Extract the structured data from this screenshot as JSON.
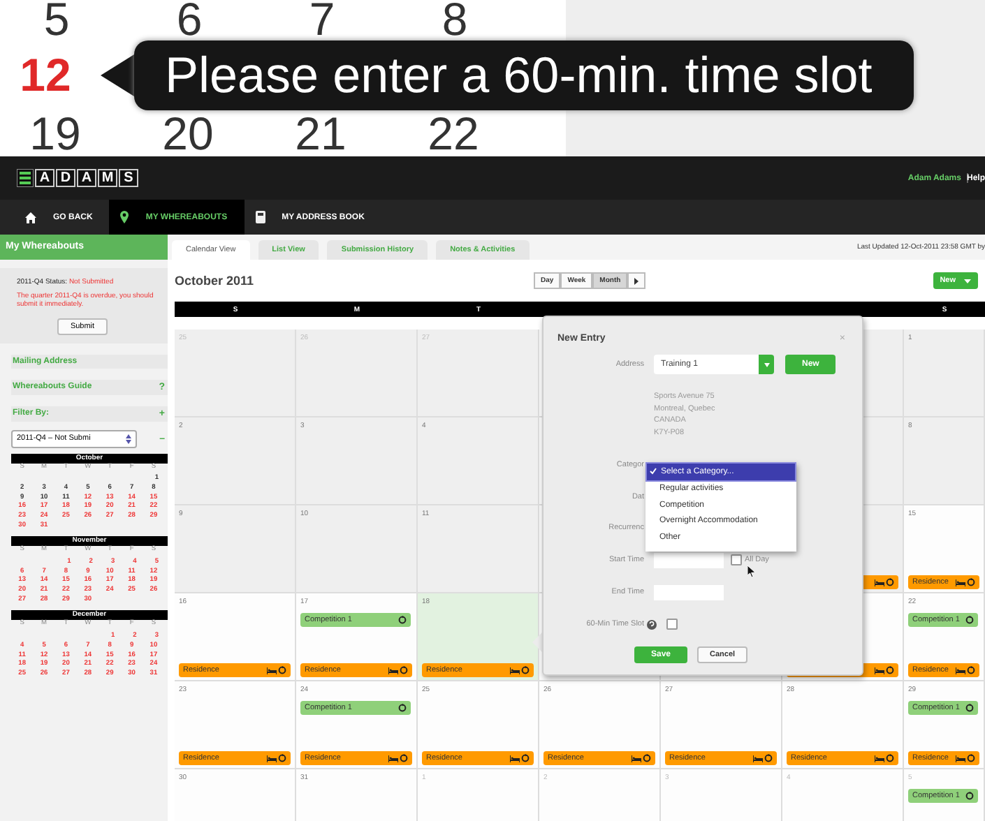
{
  "callout": {
    "dates_above": [
      "5",
      "6",
      "7",
      "8"
    ],
    "today": "12",
    "tooltip": "Please enter a 60-min. time slot",
    "dates_below": [
      "19",
      "20",
      "21",
      "22"
    ]
  },
  "header": {
    "logo_letters": [
      "A",
      "D",
      "A",
      "M",
      "S"
    ],
    "user": "Adam Adams",
    "help": "Help"
  },
  "nav": [
    {
      "label": "GO BACK",
      "kind": "home",
      "selected": false
    },
    {
      "label": "MY WHEREABOUTS",
      "kind": "pin",
      "selected": true
    },
    {
      "label": "MY ADDRESS BOOK",
      "kind": "book",
      "selected": false
    }
  ],
  "sidebar": {
    "title": "My Whereabouts",
    "status_label": "2011-Q4 Status:",
    "status_value": "Not Submitted",
    "warning": "The quarter 2011-Q4 is overdue, you should submit it immediately.",
    "submit": "Submit",
    "links": [
      {
        "label": "Mailing Address"
      },
      {
        "label": "Whereabouts Guide",
        "action": "?"
      },
      {
        "label": "Filter By:",
        "action": "+"
      }
    ],
    "filter": {
      "value": "2011-Q4 – Not Submi",
      "action": "–"
    },
    "months": [
      {
        "name": "October",
        "weekdays": [
          "S",
          "M",
          "T",
          "W",
          "T",
          "F",
          "S"
        ],
        "weeks": [
          [
            {
              "day": "1",
              "upcoming": false
            }
          ],
          [
            {
              "day": "2",
              "upcoming": false
            },
            {
              "day": "3",
              "upcoming": false
            },
            {
              "day": "4",
              "upcoming": false
            },
            {
              "day": "5",
              "upcoming": false
            },
            {
              "day": "6",
              "upcoming": false
            },
            {
              "day": "7",
              "upcoming": false
            },
            {
              "day": "8",
              "upcoming": false
            }
          ],
          [
            {
              "day": "9",
              "upcoming": false
            },
            {
              "day": "10",
              "upcoming": false
            },
            {
              "day": "11",
              "upcoming": false
            },
            {
              "day": "12",
              "upcoming": true
            },
            {
              "day": "13",
              "upcoming": true
            },
            {
              "day": "14",
              "upcoming": true
            },
            {
              "day": "15",
              "upcoming": true
            }
          ],
          [
            {
              "day": "16",
              "upcoming": true
            },
            {
              "day": "17",
              "upcoming": true
            },
            {
              "day": "18",
              "upcoming": true
            },
            {
              "day": "19",
              "upcoming": true
            },
            {
              "day": "20",
              "upcoming": true
            },
            {
              "day": "21",
              "upcoming": true
            },
            {
              "day": "22",
              "upcoming": true
            }
          ],
          [
            {
              "day": "23",
              "upcoming": true
            },
            {
              "day": "24",
              "upcoming": true
            },
            {
              "day": "25",
              "upcoming": true
            },
            {
              "day": "26",
              "upcoming": true
            },
            {
              "day": "27",
              "upcoming": true
            },
            {
              "day": "28",
              "upcoming": true
            },
            {
              "day": "29",
              "upcoming": true
            }
          ],
          [
            {
              "day": "30",
              "upcoming": true
            },
            {
              "day": "31",
              "upcoming": true
            }
          ]
        ]
      },
      {
        "name": "November",
        "weekdays": [
          "S",
          "M",
          "T",
          "W",
          "T",
          "F",
          "S"
        ],
        "weeks": [
          [
            {
              "day": "1",
              "upcoming": true
            },
            {
              "day": "2",
              "upcoming": true
            },
            {
              "day": "3",
              "upcoming": true
            },
            {
              "day": "4",
              "upcoming": true
            },
            {
              "day": "5",
              "upcoming": true
            }
          ],
          [
            {
              "day": "6",
              "upcoming": true
            },
            {
              "day": "7",
              "upcoming": true
            },
            {
              "day": "8",
              "upcoming": true
            },
            {
              "day": "9",
              "upcoming": true
            },
            {
              "day": "10",
              "upcoming": true
            },
            {
              "day": "11",
              "upcoming": true
            },
            {
              "day": "12",
              "upcoming": true
            }
          ],
          [
            {
              "day": "13",
              "upcoming": true
            },
            {
              "day": "14",
              "upcoming": true
            },
            {
              "day": "15",
              "upcoming": true
            },
            {
              "day": "16",
              "upcoming": true
            },
            {
              "day": "17",
              "upcoming": true
            },
            {
              "day": "18",
              "upcoming": true
            },
            {
              "day": "19",
              "upcoming": true
            }
          ],
          [
            {
              "day": "20",
              "upcoming": true
            },
            {
              "day": "21",
              "upcoming": true
            },
            {
              "day": "22",
              "upcoming": true
            },
            {
              "day": "23",
              "upcoming": true
            },
            {
              "day": "24",
              "upcoming": true
            },
            {
              "day": "25",
              "upcoming": true
            },
            {
              "day": "26",
              "upcoming": true
            }
          ],
          [
            {
              "day": "27",
              "upcoming": true
            },
            {
              "day": "28",
              "upcoming": true
            },
            {
              "day": "29",
              "upcoming": true
            },
            {
              "day": "30",
              "upcoming": true
            }
          ]
        ]
      },
      {
        "name": "December",
        "weekdays": [
          "S",
          "M",
          "T",
          "W",
          "T",
          "F",
          "S"
        ],
        "weeks": [
          [
            {
              "day": "1",
              "upcoming": true
            },
            {
              "day": "2",
              "upcoming": true
            },
            {
              "day": "3",
              "upcoming": true
            }
          ],
          [
            {
              "day": "4",
              "upcoming": true
            },
            {
              "day": "5",
              "upcoming": true
            },
            {
              "day": "6",
              "upcoming": true
            },
            {
              "day": "7",
              "upcoming": true
            },
            {
              "day": "8",
              "upcoming": true
            },
            {
              "day": "9",
              "upcoming": true
            },
            {
              "day": "10",
              "upcoming": true
            }
          ],
          [
            {
              "day": "11",
              "upcoming": true
            },
            {
              "day": "12",
              "upcoming": true
            },
            {
              "day": "13",
              "upcoming": true
            },
            {
              "day": "14",
              "upcoming": true
            },
            {
              "day": "15",
              "upcoming": true
            },
            {
              "day": "16",
              "upcoming": true
            },
            {
              "day": "17",
              "upcoming": true
            }
          ],
          [
            {
              "day": "18",
              "upcoming": true
            },
            {
              "day": "19",
              "upcoming": true
            },
            {
              "day": "20",
              "upcoming": true
            },
            {
              "day": "21",
              "upcoming": true
            },
            {
              "day": "22",
              "upcoming": true
            },
            {
              "day": "23",
              "upcoming": true
            },
            {
              "day": "24",
              "upcoming": true
            }
          ],
          [
            {
              "day": "25",
              "upcoming": true
            },
            {
              "day": "26",
              "upcoming": true
            },
            {
              "day": "27",
              "upcoming": true
            },
            {
              "day": "28",
              "upcoming": true
            },
            {
              "day": "29",
              "upcoming": true
            },
            {
              "day": "30",
              "upcoming": true
            },
            {
              "day": "31",
              "upcoming": true
            }
          ]
        ]
      }
    ]
  },
  "tabs": [
    {
      "label": "Calendar View",
      "selected": true
    },
    {
      "label": "List View",
      "selected": false
    },
    {
      "label": "Submission History",
      "selected": false
    },
    {
      "label": "Notes & Activities",
      "selected": false
    }
  ],
  "last_updated": "Last Updated 12-Oct-2011 23:58 GMT by",
  "calendar": {
    "title": "October 2011",
    "views": [
      {
        "label": "Day",
        "selected": false
      },
      {
        "label": "Week",
        "selected": false
      },
      {
        "label": "Month",
        "selected": true
      }
    ],
    "new_button": "New",
    "weekdays": [
      "S",
      "M",
      "T",
      "S"
    ],
    "weeks": [
      [
        {
          "date": "25",
          "other_month": true,
          "past": true,
          "selected": false
        },
        {
          "date": "26",
          "other_month": true,
          "past": true,
          "selected": false
        },
        {
          "date": "27",
          "other_month": true,
          "past": true,
          "selected": false
        },
        {
          "past": true,
          "selected": false
        },
        {
          "date": "1",
          "other_month": false,
          "past": true,
          "selected": false
        }
      ],
      [
        {
          "date": "2",
          "other_month": false,
          "past": true,
          "selected": false
        },
        {
          "date": "3",
          "other_month": false,
          "past": true,
          "selected": false
        },
        {
          "date": "4",
          "other_month": false,
          "past": true,
          "selected": false
        },
        {
          "past": true,
          "selected": false
        },
        {
          "date": "8",
          "other_month": false,
          "past": true,
          "selected": false
        }
      ],
      [
        {
          "date": "9",
          "other_month": false,
          "past": true,
          "selected": false
        },
        {
          "date": "10",
          "other_month": false,
          "past": true,
          "selected": false
        },
        {
          "date": "11",
          "other_month": false,
          "past": true,
          "selected": false
        },
        {
          "past": true,
          "selected": false,
          "events": [
            {
              "kind": "residence"
            }
          ]
        },
        {
          "date": "15",
          "other_month": false,
          "past": false,
          "selected": false,
          "events": [
            {
              "kind": "residence",
              "label": "Residence"
            }
          ]
        }
      ],
      [
        {
          "date": "16",
          "other_month": false,
          "past": false,
          "selected": false,
          "events": [
            {
              "kind": "residence",
              "label": "Residence"
            }
          ]
        },
        {
          "date": "17",
          "other_month": false,
          "past": false,
          "selected": false,
          "events": [
            {
              "kind": "competition",
              "label": "Competition 1"
            },
            {
              "kind": "residence",
              "label": "Residence"
            }
          ]
        },
        {
          "date": "18",
          "other_month": false,
          "past": false,
          "selected": true,
          "events": [
            {
              "kind": "residence",
              "label": "Residence"
            }
          ]
        },
        {
          "past": false,
          "selected": false,
          "events": [
            {
              "kind": "residence"
            }
          ]
        },
        {
          "date": "22",
          "other_month": false,
          "past": false,
          "selected": false,
          "events": [
            {
              "kind": "competition",
              "label": "Competition 1"
            },
            {
              "kind": "residence",
              "label": "Residence"
            }
          ]
        }
      ],
      [
        {
          "date": "23",
          "other_month": false,
          "past": false,
          "selected": false,
          "events": [
            {
              "kind": "residence",
              "label": "Residence"
            }
          ]
        },
        {
          "date": "24",
          "other_month": false,
          "past": false,
          "selected": false,
          "events": [
            {
              "kind": "competition",
              "label": "Competition 1"
            },
            {
              "kind": "residence",
              "label": "Residence"
            }
          ]
        },
        {
          "date": "25",
          "other_month": false,
          "past": false,
          "selected": false,
          "events": [
            {
              "kind": "residence",
              "label": "Residence"
            }
          ]
        },
        {
          "date": "26",
          "other_month": false,
          "past": false,
          "selected": false,
          "events": [
            {
              "kind": "residence",
              "label": "Residence"
            }
          ]
        },
        {
          "date": "27",
          "other_month": false,
          "past": false,
          "selected": false,
          "events": [
            {
              "kind": "residence",
              "label": "Residence"
            }
          ]
        },
        {
          "date": "28",
          "other_month": false,
          "past": false,
          "selected": false,
          "events": [
            {
              "kind": "residence",
              "label": "Residence"
            }
          ]
        },
        {
          "date": "29",
          "other_month": false,
          "past": false,
          "selected": false,
          "events": [
            {
              "kind": "competition",
              "label": "Competition 1"
            },
            {
              "kind": "residence",
              "label": "Residence"
            }
          ]
        }
      ],
      [
        {
          "date": "30",
          "other_month": false,
          "past": false,
          "selected": false
        },
        {
          "date": "31",
          "other_month": false,
          "past": false,
          "selected": false
        },
        {
          "date": "1",
          "other_month": true,
          "past": false,
          "selected": false
        },
        {
          "date": "2",
          "other_month": true,
          "past": false,
          "selected": false
        },
        {
          "date": "3",
          "other_month": true,
          "past": false,
          "selected": false
        },
        {
          "date": "4",
          "other_month": true,
          "past": false,
          "selected": false
        },
        {
          "date": "5",
          "other_month": true,
          "past": false,
          "selected": false,
          "events": [
            {
              "kind": "competition",
              "label": "Competition 1"
            }
          ]
        }
      ]
    ]
  },
  "dialog": {
    "title": "New Entry",
    "close": "×",
    "address_label": "Address",
    "address_value": "Training 1",
    "new_button": "New",
    "address_lines": [
      "Sports Avenue 75",
      "Montreal, Quebec",
      "CANADA",
      "K7Y-P08"
    ],
    "rows": [
      {
        "kind": "label",
        "label": "Categor"
      },
      {
        "kind": "label",
        "label": "Dat"
      },
      {
        "kind": "label",
        "label": "Recurrenc"
      },
      {
        "kind": "time",
        "label": "Start Time",
        "all_day": {
          "label": "All Day",
          "checked": false
        }
      },
      {
        "kind": "time",
        "label": "End Time"
      },
      {
        "kind": "checkbox",
        "label": "60-Min Time Slot",
        "help": true,
        "checked": false
      }
    ],
    "category_menu": [
      {
        "label": "Select a Category...",
        "selected": true
      },
      {
        "label": "Regular activities",
        "selected": false
      },
      {
        "label": "Competition",
        "selected": false
      },
      {
        "label": "Overnight Accommodation",
        "selected": false
      },
      {
        "label": "Other",
        "selected": false
      }
    ],
    "buttons": [
      {
        "label": "Save",
        "kind": "primary"
      },
      {
        "label": "Cancel",
        "kind": "secondary"
      }
    ]
  }
}
